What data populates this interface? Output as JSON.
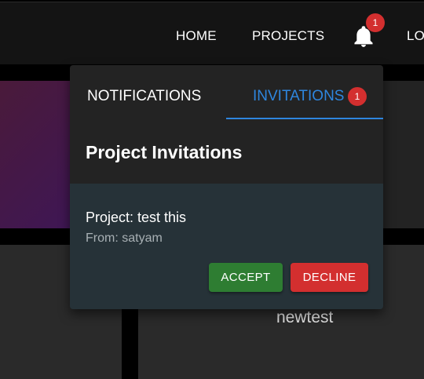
{
  "nav": {
    "home": "HOME",
    "projects": "PROJECTS",
    "logout_partial": "LO",
    "bell_badge": "1",
    "bell_icon": "bell-icon"
  },
  "background": {
    "card_title_partial": "newtest"
  },
  "popup": {
    "tabs": [
      {
        "label": "NOTIFICATIONS"
      },
      {
        "label": "INVITATIONS",
        "badge": "1"
      }
    ],
    "section_title": "Project Invitations",
    "invitation": {
      "project": "Project: test this",
      "from": "From: satyam",
      "accept_label": "ACCEPT",
      "decline_label": "DECLINE"
    }
  },
  "colors": {
    "accent": "#2e86de",
    "badge": "#d32f2f",
    "accept": "#2e7d32",
    "decline": "#d32f2f",
    "card_bg": "#263238"
  }
}
